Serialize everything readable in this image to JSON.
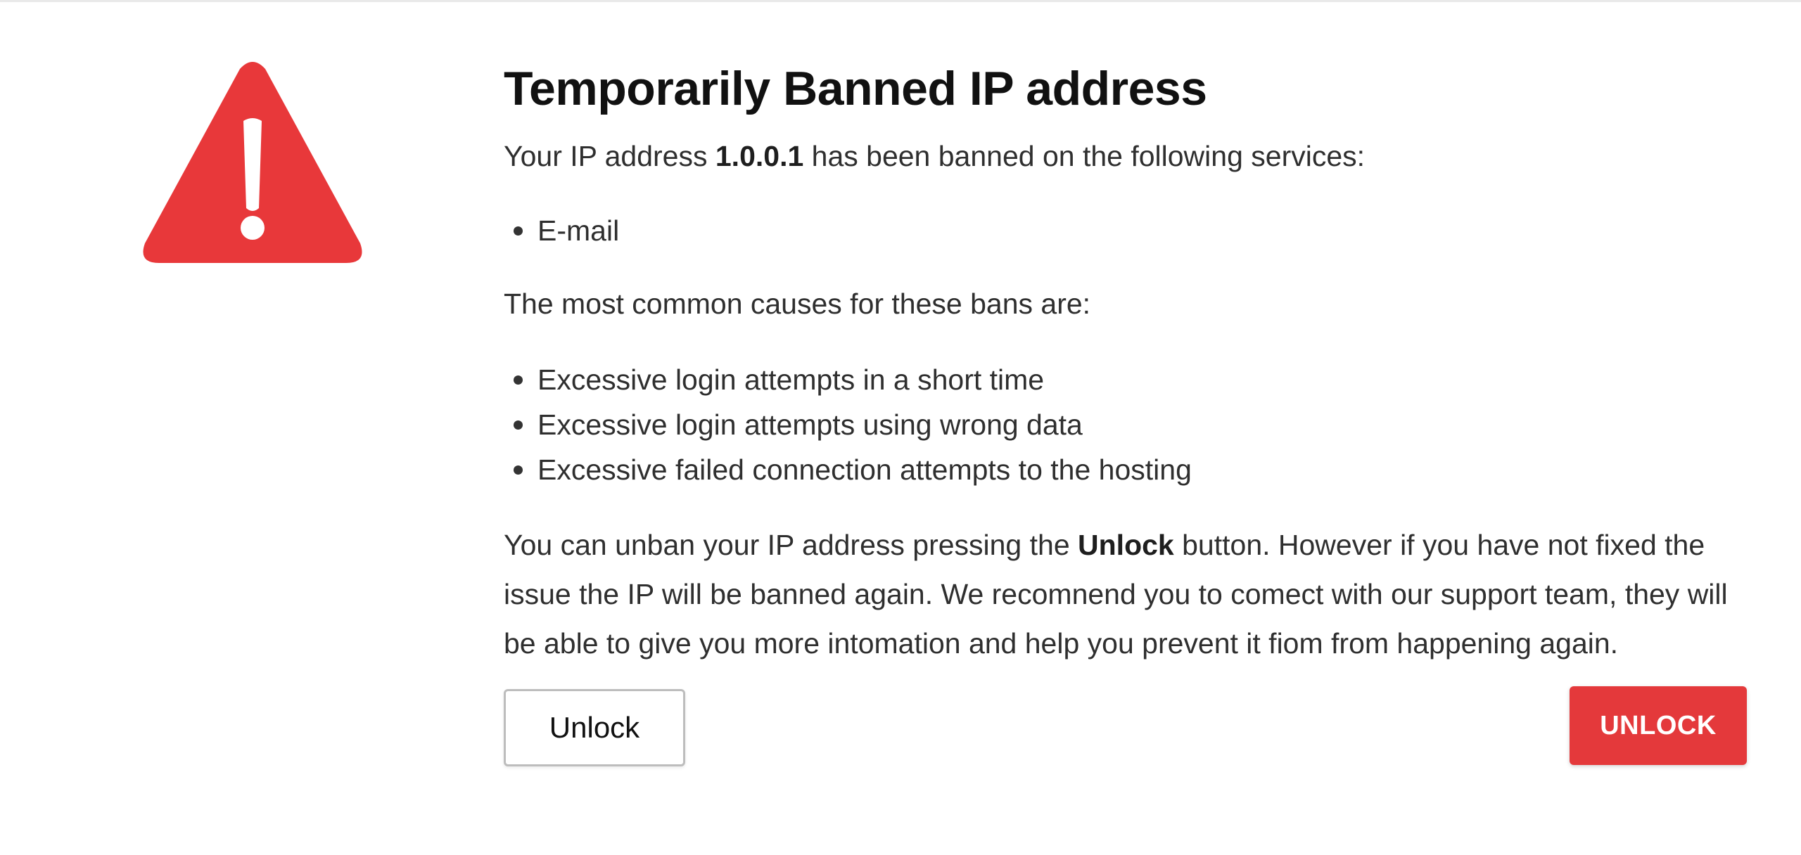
{
  "page": {
    "title": "Temporarily Banned IP address",
    "intro": {
      "before": "Your IP address ",
      "ip": "1.0.0.1",
      "after": " has been banned on the following services:"
    },
    "services": [
      "E-mail"
    ],
    "causes_heading": "The most common causes for these bans are:",
    "causes": [
      "Excessive login attempts in a short time",
      "Excessive login attempts using wrong data",
      "Excessive failed connection attempts to the hosting"
    ],
    "unban": {
      "before": "You can unban your IP address pressing the ",
      "bold": "Unlock",
      "after": " button. However if you have not fixed the issue the IP will be banned again. We recomnend you to comect with our support team, they will be able to give you more intomation and help you prevent it fiom from happening again."
    }
  },
  "buttons": {
    "unlock_outline": "Unlock",
    "unlock_primary": "UNLOCK"
  },
  "icons": {
    "warning": "warning-triangle-icon"
  },
  "colors": {
    "danger": "#e4393b",
    "icon_red": "#e8383a"
  }
}
